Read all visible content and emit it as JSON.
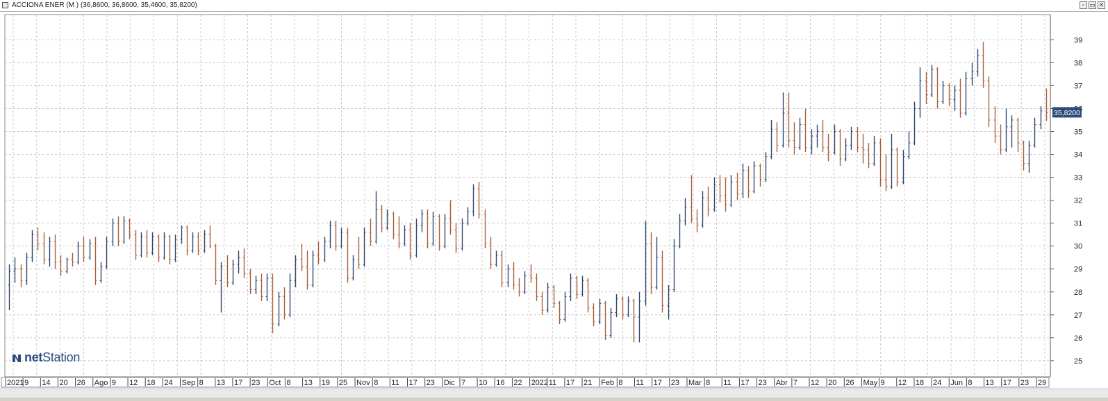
{
  "window": {
    "title": "ACCIONA ENER (M ) (36,8600, 36,8600, 35,4600, 35,8200)",
    "buttons": [
      "▫",
      "▭",
      "✕"
    ]
  },
  "logo": {
    "prefix": "net",
    "suffix": "Station"
  },
  "colors": {
    "up": "#33456e",
    "down": "#a8603a",
    "grid": "#c8c8c8",
    "price_tag_bg": "#2e4a78"
  },
  "chart_data": {
    "type": "ohlc",
    "instrument": "ACCIONA ENER (M )",
    "last_ohlc": {
      "open": 36.86,
      "high": 36.86,
      "low": 35.46,
      "close": 35.82
    },
    "price_tag": "35,8200",
    "ylim": [
      24.3,
      40.1
    ],
    "yticks": [
      25,
      26,
      27,
      28,
      29,
      30,
      31,
      32,
      33,
      34,
      35,
      36,
      37,
      38,
      39
    ],
    "grid": true,
    "x_tick_labels": [
      "2021",
      "9",
      "14",
      "20",
      "26",
      "Ago",
      "9",
      "12",
      "18",
      "24",
      "Sep",
      "8",
      "13",
      "17",
      "23",
      "Oct",
      "8",
      "13",
      "19",
      "25",
      "Nov",
      "8",
      "11",
      "17",
      "23",
      "Dic",
      "7",
      "10",
      "16",
      "22",
      "2022",
      "11",
      "17",
      "21",
      "Feb",
      "8",
      "11",
      "17",
      "23",
      "Mar",
      "8",
      "11",
      "17",
      "23",
      "Abr",
      "7",
      "12",
      "20",
      "26",
      "May",
      "9",
      "12",
      "18",
      "24",
      "Jun",
      "8",
      "13",
      "17",
      "23",
      "29"
    ],
    "bars": [
      {
        "o": 28.3,
        "h": 29.2,
        "l": 27.2,
        "c": 28.9
      },
      {
        "o": 28.9,
        "h": 29.5,
        "l": 28.4,
        "c": 29.0
      },
      {
        "o": 29.0,
        "h": 29.2,
        "l": 28.2,
        "c": 28.5
      },
      {
        "o": 28.5,
        "h": 29.7,
        "l": 28.3,
        "c": 29.5
      },
      {
        "o": 29.5,
        "h": 30.7,
        "l": 29.3,
        "c": 30.5
      },
      {
        "o": 30.5,
        "h": 30.8,
        "l": 29.8,
        "c": 30.1
      },
      {
        "o": 30.1,
        "h": 30.6,
        "l": 29.2,
        "c": 29.4
      },
      {
        "o": 29.4,
        "h": 30.4,
        "l": 29.1,
        "c": 30.2
      },
      {
        "o": 30.2,
        "h": 30.5,
        "l": 29.0,
        "c": 29.3
      },
      {
        "o": 29.3,
        "h": 29.6,
        "l": 28.7,
        "c": 28.9
      },
      {
        "o": 28.9,
        "h": 29.5,
        "l": 28.8,
        "c": 29.4
      },
      {
        "o": 29.4,
        "h": 29.7,
        "l": 29.1,
        "c": 29.3
      },
      {
        "o": 29.3,
        "h": 30.2,
        "l": 29.2,
        "c": 30.0
      },
      {
        "o": 30.0,
        "h": 30.4,
        "l": 29.3,
        "c": 29.5
      },
      {
        "o": 29.5,
        "h": 30.3,
        "l": 29.4,
        "c": 30.1
      },
      {
        "o": 30.1,
        "h": 30.4,
        "l": 28.3,
        "c": 28.5
      },
      {
        "o": 28.5,
        "h": 29.3,
        "l": 28.4,
        "c": 29.1
      },
      {
        "o": 29.1,
        "h": 30.4,
        "l": 29.0,
        "c": 30.2
      },
      {
        "o": 30.2,
        "h": 31.2,
        "l": 30.0,
        "c": 31.0
      },
      {
        "o": 31.0,
        "h": 31.3,
        "l": 30.0,
        "c": 30.2
      },
      {
        "o": 30.2,
        "h": 31.3,
        "l": 30.1,
        "c": 31.1
      },
      {
        "o": 31.1,
        "h": 31.2,
        "l": 30.3,
        "c": 30.5
      },
      {
        "o": 30.5,
        "h": 30.7,
        "l": 29.4,
        "c": 29.6
      },
      {
        "o": 29.6,
        "h": 30.6,
        "l": 29.5,
        "c": 30.4
      },
      {
        "o": 30.4,
        "h": 30.7,
        "l": 29.5,
        "c": 29.7
      },
      {
        "o": 29.7,
        "h": 30.6,
        "l": 29.6,
        "c": 30.4
      },
      {
        "o": 30.4,
        "h": 30.5,
        "l": 29.3,
        "c": 29.5
      },
      {
        "o": 29.5,
        "h": 30.6,
        "l": 29.4,
        "c": 30.4
      },
      {
        "o": 30.4,
        "h": 30.5,
        "l": 29.2,
        "c": 29.4
      },
      {
        "o": 29.4,
        "h": 30.5,
        "l": 29.3,
        "c": 30.3
      },
      {
        "o": 30.3,
        "h": 30.9,
        "l": 30.1,
        "c": 30.8
      },
      {
        "o": 30.8,
        "h": 30.9,
        "l": 29.6,
        "c": 29.8
      },
      {
        "o": 29.8,
        "h": 30.6,
        "l": 29.7,
        "c": 30.4
      },
      {
        "o": 30.4,
        "h": 30.6,
        "l": 29.6,
        "c": 29.8
      },
      {
        "o": 29.8,
        "h": 30.7,
        "l": 29.7,
        "c": 30.5
      },
      {
        "o": 30.5,
        "h": 30.9,
        "l": 29.9,
        "c": 30.0
      },
      {
        "o": 30.0,
        "h": 30.1,
        "l": 28.3,
        "c": 28.5
      },
      {
        "o": 28.5,
        "h": 29.3,
        "l": 27.1,
        "c": 29.1
      },
      {
        "o": 29.1,
        "h": 29.6,
        "l": 28.2,
        "c": 28.4
      },
      {
        "o": 28.4,
        "h": 29.4,
        "l": 28.3,
        "c": 29.2
      },
      {
        "o": 29.2,
        "h": 29.8,
        "l": 28.8,
        "c": 29.5
      },
      {
        "o": 29.5,
        "h": 29.9,
        "l": 28.6,
        "c": 28.8
      },
      {
        "o": 28.8,
        "h": 29.0,
        "l": 27.9,
        "c": 28.1
      },
      {
        "o": 28.1,
        "h": 28.7,
        "l": 27.9,
        "c": 28.5
      },
      {
        "o": 28.5,
        "h": 28.8,
        "l": 27.6,
        "c": 27.8
      },
      {
        "o": 27.8,
        "h": 28.8,
        "l": 27.6,
        "c": 28.6
      },
      {
        "o": 28.6,
        "h": 28.8,
        "l": 26.2,
        "c": 26.6
      },
      {
        "o": 26.6,
        "h": 28.0,
        "l": 26.5,
        "c": 27.8
      },
      {
        "o": 27.8,
        "h": 28.2,
        "l": 26.8,
        "c": 27.0
      },
      {
        "o": 27.0,
        "h": 28.8,
        "l": 26.9,
        "c": 28.5
      },
      {
        "o": 28.5,
        "h": 29.6,
        "l": 28.2,
        "c": 29.4
      },
      {
        "o": 29.4,
        "h": 30.1,
        "l": 28.9,
        "c": 29.1
      },
      {
        "o": 29.1,
        "h": 29.8,
        "l": 28.1,
        "c": 28.3
      },
      {
        "o": 28.3,
        "h": 29.8,
        "l": 28.2,
        "c": 29.6
      },
      {
        "o": 29.6,
        "h": 30.2,
        "l": 29.2,
        "c": 29.4
      },
      {
        "o": 29.4,
        "h": 30.4,
        "l": 29.3,
        "c": 30.2
      },
      {
        "o": 30.2,
        "h": 31.1,
        "l": 29.9,
        "c": 30.9
      },
      {
        "o": 30.9,
        "h": 31.1,
        "l": 29.8,
        "c": 30.0
      },
      {
        "o": 30.0,
        "h": 30.8,
        "l": 29.9,
        "c": 30.6
      },
      {
        "o": 30.6,
        "h": 30.8,
        "l": 28.4,
        "c": 28.6
      },
      {
        "o": 28.6,
        "h": 29.6,
        "l": 28.5,
        "c": 29.4
      },
      {
        "o": 29.4,
        "h": 30.4,
        "l": 29.0,
        "c": 29.2
      },
      {
        "o": 29.2,
        "h": 30.8,
        "l": 29.1,
        "c": 30.6
      },
      {
        "o": 30.6,
        "h": 31.2,
        "l": 30.0,
        "c": 30.2
      },
      {
        "o": 30.2,
        "h": 32.4,
        "l": 30.1,
        "c": 31.6
      },
      {
        "o": 31.6,
        "h": 31.8,
        "l": 30.6,
        "c": 30.8
      },
      {
        "o": 30.8,
        "h": 31.6,
        "l": 30.7,
        "c": 31.4
      },
      {
        "o": 31.4,
        "h": 31.5,
        "l": 30.3,
        "c": 30.5
      },
      {
        "o": 30.5,
        "h": 31.3,
        "l": 29.9,
        "c": 30.1
      },
      {
        "o": 30.1,
        "h": 30.9,
        "l": 30.0,
        "c": 30.7
      },
      {
        "o": 30.7,
        "h": 31.0,
        "l": 29.4,
        "c": 29.6
      },
      {
        "o": 29.6,
        "h": 31.2,
        "l": 29.5,
        "c": 30.9
      },
      {
        "o": 30.9,
        "h": 31.6,
        "l": 30.6,
        "c": 31.4
      },
      {
        "o": 31.4,
        "h": 31.6,
        "l": 29.9,
        "c": 30.1
      },
      {
        "o": 30.1,
        "h": 31.5,
        "l": 30.0,
        "c": 31.3
      },
      {
        "o": 31.3,
        "h": 31.4,
        "l": 29.8,
        "c": 30.0
      },
      {
        "o": 30.0,
        "h": 31.4,
        "l": 29.9,
        "c": 31.2
      },
      {
        "o": 31.2,
        "h": 32.0,
        "l": 30.5,
        "c": 30.7
      },
      {
        "o": 30.7,
        "h": 31.0,
        "l": 29.7,
        "c": 29.9
      },
      {
        "o": 29.9,
        "h": 31.2,
        "l": 29.8,
        "c": 31.0
      },
      {
        "o": 31.0,
        "h": 31.7,
        "l": 30.9,
        "c": 31.5
      },
      {
        "o": 31.5,
        "h": 32.7,
        "l": 31.3,
        "c": 32.5
      },
      {
        "o": 32.5,
        "h": 32.8,
        "l": 31.2,
        "c": 31.4
      },
      {
        "o": 31.4,
        "h": 31.6,
        "l": 29.9,
        "c": 30.1
      },
      {
        "o": 30.1,
        "h": 30.4,
        "l": 29.0,
        "c": 29.2
      },
      {
        "o": 29.2,
        "h": 29.8,
        "l": 29.1,
        "c": 29.6
      },
      {
        "o": 29.6,
        "h": 29.8,
        "l": 28.2,
        "c": 28.4
      },
      {
        "o": 28.4,
        "h": 29.2,
        "l": 28.2,
        "c": 29.0
      },
      {
        "o": 29.0,
        "h": 29.3,
        "l": 28.1,
        "c": 28.3
      },
      {
        "o": 28.3,
        "h": 28.6,
        "l": 27.8,
        "c": 28.0
      },
      {
        "o": 28.0,
        "h": 28.9,
        "l": 27.9,
        "c": 28.7
      },
      {
        "o": 28.7,
        "h": 29.2,
        "l": 28.4,
        "c": 28.6
      },
      {
        "o": 28.6,
        "h": 28.8,
        "l": 27.6,
        "c": 27.8
      },
      {
        "o": 27.8,
        "h": 28.0,
        "l": 27.0,
        "c": 27.2
      },
      {
        "o": 27.2,
        "h": 28.4,
        "l": 27.1,
        "c": 28.2
      },
      {
        "o": 28.2,
        "h": 28.3,
        "l": 27.3,
        "c": 27.5
      },
      {
        "o": 27.5,
        "h": 27.6,
        "l": 26.6,
        "c": 26.8
      },
      {
        "o": 26.8,
        "h": 28.0,
        "l": 26.7,
        "c": 27.8
      },
      {
        "o": 27.8,
        "h": 28.8,
        "l": 27.6,
        "c": 28.6
      },
      {
        "o": 28.6,
        "h": 28.7,
        "l": 27.7,
        "c": 27.9
      },
      {
        "o": 27.9,
        "h": 28.7,
        "l": 27.8,
        "c": 28.5
      },
      {
        "o": 28.5,
        "h": 28.6,
        "l": 27.1,
        "c": 27.3
      },
      {
        "o": 27.3,
        "h": 27.5,
        "l": 26.5,
        "c": 26.7
      },
      {
        "o": 26.7,
        "h": 27.7,
        "l": 26.6,
        "c": 27.5
      },
      {
        "o": 27.5,
        "h": 27.6,
        "l": 25.9,
        "c": 26.1
      },
      {
        "o": 26.1,
        "h": 27.3,
        "l": 26.0,
        "c": 27.1
      },
      {
        "o": 27.1,
        "h": 27.9,
        "l": 26.9,
        "c": 27.7
      },
      {
        "o": 27.7,
        "h": 27.8,
        "l": 26.8,
        "c": 27.0
      },
      {
        "o": 27.0,
        "h": 27.8,
        "l": 26.9,
        "c": 27.6
      },
      {
        "o": 27.6,
        "h": 27.7,
        "l": 25.8,
        "c": 26.9
      },
      {
        "o": 26.9,
        "h": 28.0,
        "l": 25.8,
        "c": 27.6
      },
      {
        "o": 27.6,
        "h": 31.1,
        "l": 27.4,
        "c": 30.1
      },
      {
        "o": 30.1,
        "h": 30.6,
        "l": 27.9,
        "c": 28.2
      },
      {
        "o": 28.2,
        "h": 30.4,
        "l": 28.1,
        "c": 29.5
      },
      {
        "o": 29.5,
        "h": 29.8,
        "l": 27.1,
        "c": 27.4
      },
      {
        "o": 27.4,
        "h": 28.3,
        "l": 26.8,
        "c": 28.1
      },
      {
        "o": 28.1,
        "h": 30.3,
        "l": 28.0,
        "c": 30.0
      },
      {
        "o": 30.0,
        "h": 31.4,
        "l": 29.9,
        "c": 31.1
      },
      {
        "o": 31.1,
        "h": 32.1,
        "l": 30.9,
        "c": 31.7
      },
      {
        "o": 31.7,
        "h": 33.1,
        "l": 31.0,
        "c": 31.2
      },
      {
        "o": 31.2,
        "h": 31.6,
        "l": 30.6,
        "c": 30.9
      },
      {
        "o": 30.9,
        "h": 32.4,
        "l": 30.8,
        "c": 32.1
      },
      {
        "o": 32.1,
        "h": 32.6,
        "l": 31.3,
        "c": 31.6
      },
      {
        "o": 31.6,
        "h": 33.0,
        "l": 31.5,
        "c": 32.7
      },
      {
        "o": 32.7,
        "h": 33.1,
        "l": 31.9,
        "c": 32.2
      },
      {
        "o": 32.2,
        "h": 33.0,
        "l": 31.5,
        "c": 31.8
      },
      {
        "o": 31.8,
        "h": 33.1,
        "l": 31.7,
        "c": 32.8
      },
      {
        "o": 32.8,
        "h": 33.2,
        "l": 32.0,
        "c": 32.3
      },
      {
        "o": 32.3,
        "h": 33.6,
        "l": 32.1,
        "c": 33.3
      },
      {
        "o": 33.3,
        "h": 33.5,
        "l": 32.1,
        "c": 32.4
      },
      {
        "o": 32.4,
        "h": 33.7,
        "l": 32.3,
        "c": 33.5
      },
      {
        "o": 33.5,
        "h": 33.6,
        "l": 32.6,
        "c": 32.9
      },
      {
        "o": 32.9,
        "h": 34.1,
        "l": 32.8,
        "c": 33.9
      },
      {
        "o": 33.9,
        "h": 35.5,
        "l": 33.8,
        "c": 35.1
      },
      {
        "o": 35.1,
        "h": 35.4,
        "l": 34.1,
        "c": 34.4
      },
      {
        "o": 34.4,
        "h": 36.7,
        "l": 34.3,
        "c": 35.8
      },
      {
        "o": 35.8,
        "h": 36.7,
        "l": 34.3,
        "c": 34.6
      },
      {
        "o": 34.6,
        "h": 35.4,
        "l": 34.0,
        "c": 34.3
      },
      {
        "o": 34.3,
        "h": 35.6,
        "l": 34.2,
        "c": 35.3
      },
      {
        "o": 35.3,
        "h": 36.0,
        "l": 34.1,
        "c": 34.3
      },
      {
        "o": 34.3,
        "h": 35.1,
        "l": 34.0,
        "c": 34.8
      },
      {
        "o": 34.8,
        "h": 35.3,
        "l": 34.3,
        "c": 35.0
      },
      {
        "o": 35.0,
        "h": 35.5,
        "l": 34.1,
        "c": 34.3
      },
      {
        "o": 34.3,
        "h": 34.9,
        "l": 33.7,
        "c": 34.1
      },
      {
        "o": 34.1,
        "h": 35.3,
        "l": 34.0,
        "c": 35.0
      },
      {
        "o": 35.0,
        "h": 35.1,
        "l": 33.5,
        "c": 33.8
      },
      {
        "o": 33.8,
        "h": 34.7,
        "l": 33.7,
        "c": 34.4
      },
      {
        "o": 34.4,
        "h": 35.2,
        "l": 34.2,
        "c": 35.0
      },
      {
        "o": 35.0,
        "h": 35.2,
        "l": 34.1,
        "c": 34.3
      },
      {
        "o": 34.3,
        "h": 34.9,
        "l": 33.6,
        "c": 34.2
      },
      {
        "o": 34.2,
        "h": 34.5,
        "l": 33.4,
        "c": 33.6
      },
      {
        "o": 33.6,
        "h": 34.8,
        "l": 33.5,
        "c": 34.5
      },
      {
        "o": 34.5,
        "h": 34.7,
        "l": 32.6,
        "c": 32.9
      },
      {
        "o": 32.9,
        "h": 34.0,
        "l": 32.4,
        "c": 32.6
      },
      {
        "o": 32.6,
        "h": 34.9,
        "l": 32.5,
        "c": 34.2
      },
      {
        "o": 34.2,
        "h": 34.3,
        "l": 32.6,
        "c": 32.8
      },
      {
        "o": 32.8,
        "h": 34.2,
        "l": 32.7,
        "c": 33.9
      },
      {
        "o": 33.9,
        "h": 35.0,
        "l": 33.8,
        "c": 34.5
      },
      {
        "o": 34.5,
        "h": 36.3,
        "l": 34.4,
        "c": 36.0
      },
      {
        "o": 36.0,
        "h": 37.8,
        "l": 35.6,
        "c": 37.2
      },
      {
        "o": 37.2,
        "h": 37.6,
        "l": 36.2,
        "c": 36.6
      },
      {
        "o": 36.6,
        "h": 37.9,
        "l": 36.5,
        "c": 37.7
      },
      {
        "o": 37.7,
        "h": 37.8,
        "l": 36.0,
        "c": 36.3
      },
      {
        "o": 36.3,
        "h": 37.2,
        "l": 36.2,
        "c": 37.0
      },
      {
        "o": 37.0,
        "h": 37.1,
        "l": 36.1,
        "c": 36.4
      },
      {
        "o": 36.4,
        "h": 37.0,
        "l": 35.9,
        "c": 36.8
      },
      {
        "o": 36.8,
        "h": 37.3,
        "l": 35.6,
        "c": 35.8
      },
      {
        "o": 35.8,
        "h": 37.6,
        "l": 35.7,
        "c": 37.3
      },
      {
        "o": 37.3,
        "h": 38.0,
        "l": 37.0,
        "c": 37.6
      },
      {
        "o": 37.6,
        "h": 38.6,
        "l": 37.4,
        "c": 38.3
      },
      {
        "o": 38.3,
        "h": 38.9,
        "l": 36.9,
        "c": 37.2
      },
      {
        "o": 37.2,
        "h": 37.4,
        "l": 35.2,
        "c": 35.5
      },
      {
        "o": 35.5,
        "h": 36.1,
        "l": 34.5,
        "c": 34.8
      },
      {
        "o": 34.8,
        "h": 35.3,
        "l": 34.0,
        "c": 34.2
      },
      {
        "o": 34.2,
        "h": 36.0,
        "l": 34.1,
        "c": 35.2
      },
      {
        "o": 35.2,
        "h": 35.7,
        "l": 34.3,
        "c": 35.5
      },
      {
        "o": 35.5,
        "h": 35.6,
        "l": 34.1,
        "c": 34.5
      },
      {
        "o": 34.5,
        "h": 34.6,
        "l": 33.3,
        "c": 33.6
      },
      {
        "o": 33.6,
        "h": 34.6,
        "l": 33.2,
        "c": 34.4
      },
      {
        "o": 34.4,
        "h": 35.6,
        "l": 34.3,
        "c": 35.3
      },
      {
        "o": 35.3,
        "h": 36.1,
        "l": 35.1,
        "c": 35.9
      },
      {
        "o": 36.86,
        "h": 36.86,
        "l": 35.46,
        "c": 35.82
      }
    ]
  }
}
